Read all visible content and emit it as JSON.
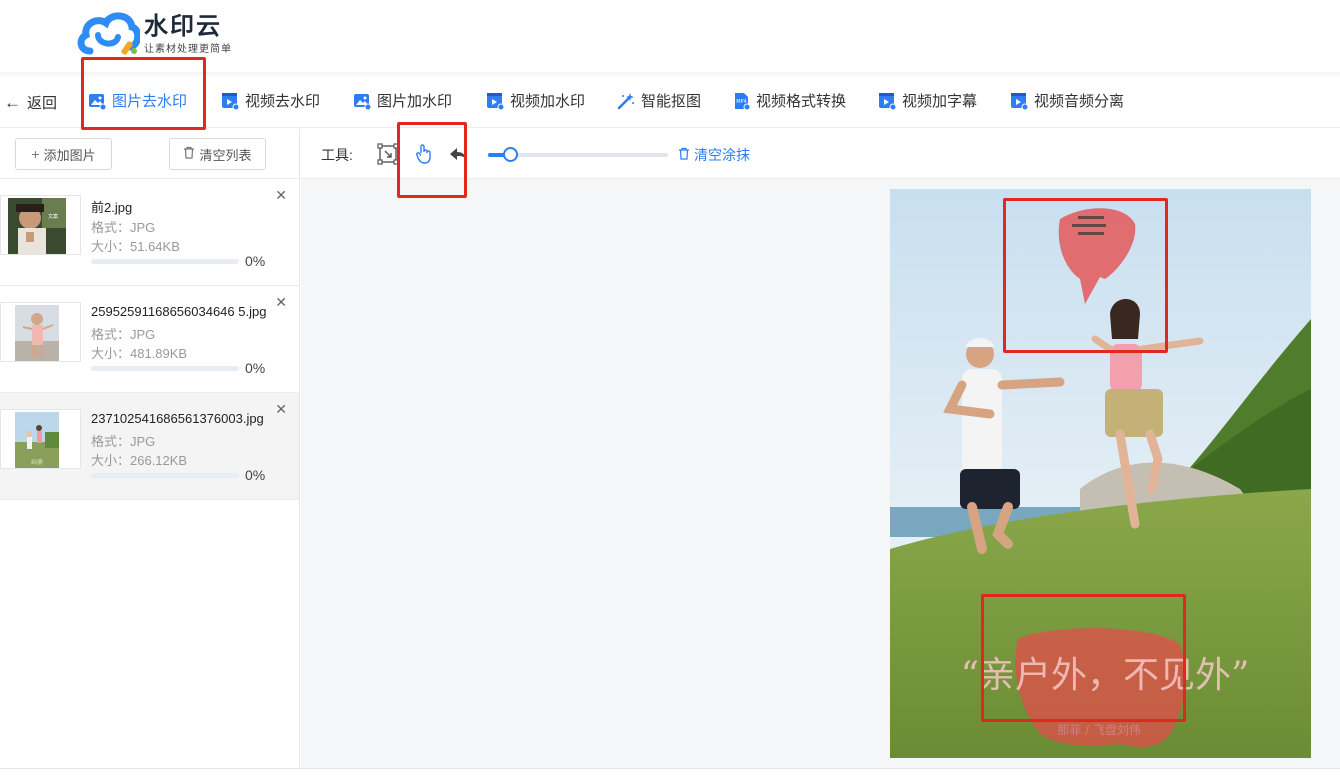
{
  "brand": {
    "name": "水印云",
    "slogan": "让素材处理更简单",
    "accent_color": "#2d7df5",
    "highlight_color": "#e0281f"
  },
  "nav": {
    "back_label": "返回",
    "back_icon": "arrow-left-icon",
    "items": [
      {
        "label": "图片去水印",
        "icon": "image-remove-icon",
        "active": true
      },
      {
        "label": "视频去水印",
        "icon": "video-icon",
        "active": false
      },
      {
        "label": "图片加水印",
        "icon": "image-add-icon",
        "active": false
      },
      {
        "label": "视频加水印",
        "icon": "video-icon",
        "active": false
      },
      {
        "label": "智能抠图",
        "icon": "magic-wand-icon",
        "active": false
      },
      {
        "label": "视频格式转换",
        "icon": "mp4-file-icon",
        "active": false
      },
      {
        "label": "视频加字幕",
        "icon": "video-icon",
        "active": false
      },
      {
        "label": "视频音频分离",
        "icon": "video-icon",
        "active": false
      }
    ]
  },
  "file_panel": {
    "add_button": "添加图片",
    "clear_list_button": "清空列表",
    "files": [
      {
        "name": "前2.jpg",
        "format": "格式：JPG",
        "size": "大小：51.64KB",
        "progress_text": "0%",
        "progress": 0
      },
      {
        "name": "25952591168656034646 5.jpg",
        "format": "格式：JPG",
        "size": "大小：481.89KB",
        "progress_text": "0%",
        "progress": 0
      },
      {
        "name": "237102541686561376003.jpg",
        "format": "格式：JPG",
        "size": "大小：266.12KB",
        "progress_text": "0%",
        "progress": 0
      }
    ]
  },
  "tools": {
    "label": "工具:",
    "select_tool_icon": "selection-box-icon",
    "hand_tool_icon": "hand-pointer-icon",
    "undo_icon": "undo-arrow-icon",
    "brush_size": 0.12,
    "clear_label": "清空涂抹"
  },
  "photo": {
    "caption_text": "“亲户外，不见外”",
    "credit_text": "那菲 / 飞盘刘伟"
  }
}
